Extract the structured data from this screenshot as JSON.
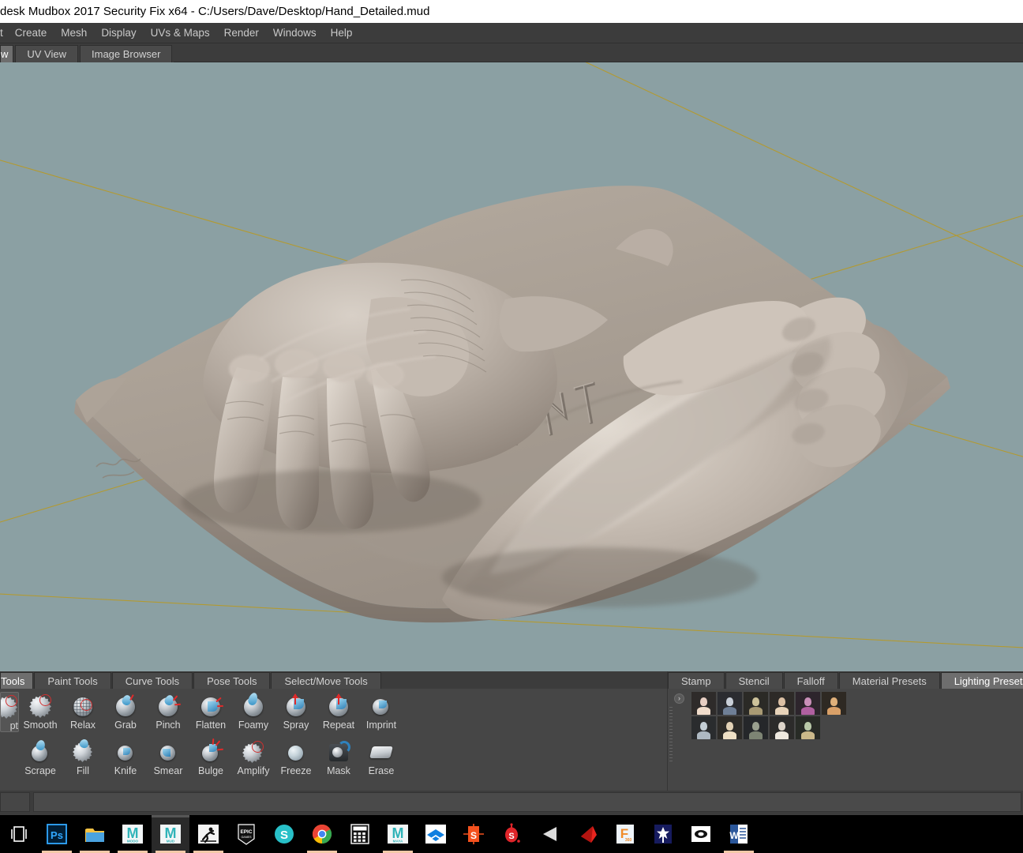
{
  "window": {
    "title": "desk Mudbox 2017 Security Fix x64 - C:/Users/Dave/Desktop/Hand_Detailed.mud",
    "title_truncated_left": true
  },
  "menubar": {
    "items": [
      {
        "label": "t",
        "name": "menu-select-clipped",
        "clipped": true
      },
      {
        "label": "Create",
        "name": "menu-create"
      },
      {
        "label": "Mesh",
        "name": "menu-mesh"
      },
      {
        "label": "Display",
        "name": "menu-display"
      },
      {
        "label": "UVs & Maps",
        "name": "menu-uvs-maps"
      },
      {
        "label": "Render",
        "name": "menu-render"
      },
      {
        "label": "Windows",
        "name": "menu-windows"
      },
      {
        "label": "Help",
        "name": "menu-help"
      }
    ]
  },
  "view_tabs": {
    "items": [
      {
        "label": "w",
        "name": "tab-3d-view",
        "active": true,
        "clipped": true
      },
      {
        "label": "UV View",
        "name": "tab-uv-view",
        "active": false
      },
      {
        "label": "Image Browser",
        "name": "tab-image-browser",
        "active": false
      }
    ]
  },
  "viewport": {
    "background_color": "#8ba0a3",
    "grid_color": "#b59a2c",
    "model_color": "#b3a99f",
    "model_description": "Two sculpted hands resting on a clay slab with engraved lettering"
  },
  "tool_panel": {
    "tabs": [
      {
        "label": "Tools",
        "name": "tab-sculpt-tools",
        "active": true,
        "clipped": true
      },
      {
        "label": "Paint Tools",
        "name": "tab-paint-tools",
        "active": false
      },
      {
        "label": "Curve Tools",
        "name": "tab-curve-tools",
        "active": false
      },
      {
        "label": "Pose Tools",
        "name": "tab-pose-tools",
        "active": false
      },
      {
        "label": "Select/Move Tools",
        "name": "tab-select-move-tools",
        "active": false
      }
    ],
    "row1": [
      {
        "label": "pt",
        "name": "tool-sculpt",
        "icon": "sculpt-icon",
        "selected": true,
        "clipped": true
      },
      {
        "label": "Smooth",
        "name": "tool-smooth",
        "icon": "smooth-icon"
      },
      {
        "label": "Relax",
        "name": "tool-relax",
        "icon": "relax-icon"
      },
      {
        "label": "Grab",
        "name": "tool-grab",
        "icon": "grab-icon"
      },
      {
        "label": "Pinch",
        "name": "tool-pinch",
        "icon": "pinch-icon"
      },
      {
        "label": "Flatten",
        "name": "tool-flatten",
        "icon": "flatten-icon"
      },
      {
        "label": "Foamy",
        "name": "tool-foamy",
        "icon": "foamy-icon"
      },
      {
        "label": "Spray",
        "name": "tool-spray",
        "icon": "spray-icon"
      },
      {
        "label": "Repeat",
        "name": "tool-repeat",
        "icon": "repeat-icon"
      },
      {
        "label": "Imprint",
        "name": "tool-imprint",
        "icon": "imprint-icon"
      }
    ],
    "row2": [
      {
        "label": "Scrape",
        "name": "tool-scrape",
        "icon": "scrape-icon"
      },
      {
        "label": "Fill",
        "name": "tool-fill",
        "icon": "fill-icon"
      },
      {
        "label": "Knife",
        "name": "tool-knife",
        "icon": "knife-icon"
      },
      {
        "label": "Smear",
        "name": "tool-smear",
        "icon": "smear-icon"
      },
      {
        "label": "Bulge",
        "name": "tool-bulge",
        "icon": "bulge-icon"
      },
      {
        "label": "Amplify",
        "name": "tool-amplify",
        "icon": "amplify-icon"
      },
      {
        "label": "Freeze",
        "name": "tool-freeze",
        "icon": "freeze-icon"
      },
      {
        "label": "Mask",
        "name": "tool-mask",
        "icon": "mask-icon"
      },
      {
        "label": "Erase",
        "name": "tool-erase",
        "icon": "erase-icon"
      }
    ]
  },
  "presets_panel": {
    "tabs": [
      {
        "label": "Stamp",
        "name": "tab-stamp",
        "active": false
      },
      {
        "label": "Stencil",
        "name": "tab-stencil",
        "active": false
      },
      {
        "label": "Falloff",
        "name": "tab-falloff",
        "active": false
      },
      {
        "label": "Material Presets",
        "name": "tab-material-presets",
        "active": false
      },
      {
        "label": "Lighting Presets",
        "name": "tab-lighting-presets",
        "active": true
      }
    ],
    "expand_glyph": "›",
    "thumbnails": [
      {
        "name": "lighting-preset-1",
        "head": "#e8cfc3",
        "body": "#f0dccb",
        "bg": "#2e2b2a"
      },
      {
        "name": "lighting-preset-2",
        "head": "#c9cfd8",
        "body": "#6f7f96",
        "bg": "#2b2c30"
      },
      {
        "name": "lighting-preset-3",
        "head": "#cdc29a",
        "body": "#a89a74",
        "bg": "#2b2a26"
      },
      {
        "name": "lighting-preset-4",
        "head": "#dcc0a4",
        "body": "#e8d3b9",
        "bg": "#2d2a27"
      },
      {
        "name": "lighting-preset-5",
        "head": "#c98fb8",
        "body": "#b060a0",
        "bg": "#2d252c"
      },
      {
        "name": "lighting-preset-6",
        "head": "#e0b07a",
        "body": "#d9a068",
        "bg": "#2e2923"
      },
      {
        "name": "lighting-preset-7",
        "head": "#c3cdd4",
        "body": "#aeb9c2",
        "bg": "#2a2c2e"
      },
      {
        "name": "lighting-preset-8",
        "head": "#e3d2b5",
        "body": "#efe0c4",
        "bg": "#2d2b27"
      },
      {
        "name": "lighting-preset-9",
        "head": "#9aa08f",
        "body": "#7d8474",
        "bg": "#25272a"
      },
      {
        "name": "lighting-preset-10",
        "head": "#ddd4c9",
        "body": "#efe9df",
        "bg": "#2c2b2a"
      },
      {
        "name": "lighting-preset-11",
        "head": "#b9c9a8",
        "body": "#cbb98a",
        "bg": "#282b26"
      }
    ]
  },
  "taskbar": {
    "items": [
      {
        "name": "taskview-icon",
        "label": "",
        "kind": "taskview",
        "running": false,
        "active": false
      },
      {
        "name": "photoshop-icon",
        "label": "Ps",
        "kind": "photoshop",
        "running": true,
        "active": false
      },
      {
        "name": "file-explorer-icon",
        "label": "",
        "kind": "explorer",
        "running": true,
        "active": false
      },
      {
        "name": "modo-icon",
        "label": "MODO",
        "kind": "mudbox",
        "running": true,
        "active": false
      },
      {
        "name": "mudbox-icon",
        "label": "MUD",
        "kind": "mudbox",
        "running": true,
        "active": true
      },
      {
        "name": "runner-icon",
        "label": "",
        "kind": "runner",
        "running": true,
        "active": false
      },
      {
        "name": "epic-games-icon",
        "label": "EPIC",
        "kind": "epic",
        "running": false,
        "active": false
      },
      {
        "name": "substance-gear-icon",
        "label": "",
        "kind": "substance-gear",
        "running": false,
        "active": false
      },
      {
        "name": "chrome-icon",
        "label": "",
        "kind": "chrome",
        "running": true,
        "active": false
      },
      {
        "name": "calculator-icon",
        "label": "",
        "kind": "calculator",
        "running": false,
        "active": false
      },
      {
        "name": "maya-icon",
        "label": "MAYA",
        "kind": "mudbox",
        "running": true,
        "active": false
      },
      {
        "name": "dropbox-icon",
        "label": "",
        "kind": "dropbox",
        "running": false,
        "active": false
      },
      {
        "name": "substance-designer-icon",
        "label": "S",
        "kind": "sd",
        "running": false,
        "active": false
      },
      {
        "name": "substance-painter-icon",
        "label": "S",
        "kind": "sp",
        "running": false,
        "active": false
      },
      {
        "name": "unity-icon",
        "label": "",
        "kind": "unity",
        "running": false,
        "active": false
      },
      {
        "name": "marmoset-icon",
        "label": "",
        "kind": "marmoset",
        "running": false,
        "active": false
      },
      {
        "name": "fusion360-icon",
        "label": "F",
        "kind": "fusion",
        "running": false,
        "active": false
      },
      {
        "name": "marvelous-designer-icon",
        "label": "",
        "kind": "marvelous",
        "running": false,
        "active": false
      },
      {
        "name": "oculus-icon",
        "label": "",
        "kind": "oculus",
        "running": false,
        "active": false
      },
      {
        "name": "word-icon",
        "label": "W",
        "kind": "word",
        "running": true,
        "active": false
      }
    ]
  }
}
